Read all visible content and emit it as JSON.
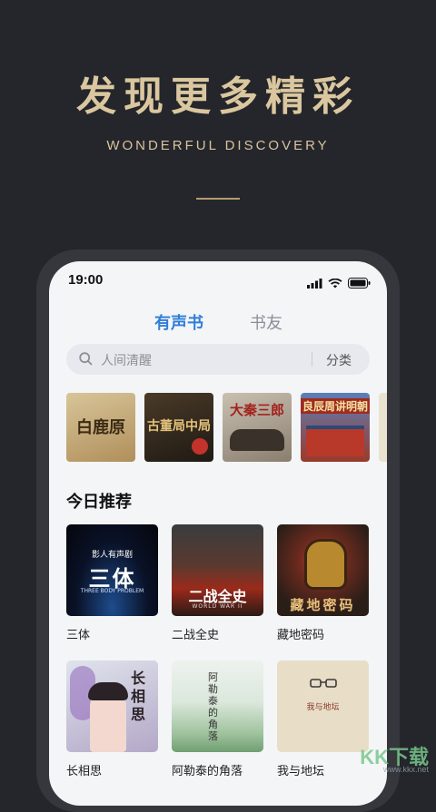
{
  "hero": {
    "title": "发现更多精彩",
    "subtitle": "WONDERFUL DISCOVERY"
  },
  "status_bar": {
    "time": "19:00",
    "icons": [
      "signal-icon",
      "wifi-icon",
      "battery-icon"
    ]
  },
  "tabs": [
    {
      "label": "有声书",
      "active": true
    },
    {
      "label": "书友",
      "active": false
    }
  ],
  "search": {
    "placeholder": "人间清醒",
    "category_label": "分类"
  },
  "featured_covers": [
    {
      "text": "白鹿原"
    },
    {
      "text": "古董局中局"
    },
    {
      "text": "大秦三郎"
    },
    {
      "text": "良辰周讲明朝"
    }
  ],
  "recommend": {
    "title": "今日推荐",
    "books": [
      {
        "title": "三体",
        "cover_main": "三体",
        "cover_top": "影人有声剧",
        "cover_sub": "THREE BODY PROBLEM"
      },
      {
        "title": "二战全史",
        "cover_main": "二战全史",
        "cover_sub": "WORLD WAR II"
      },
      {
        "title": "藏地密码",
        "cover_main": "藏地密码"
      },
      {
        "title": "长相思",
        "cover_main": "长相思"
      },
      {
        "title": "阿勒泰的角落",
        "cover_main": "阿勒泰的角落"
      },
      {
        "title": "我与地坛",
        "cover_main": "我与地坛"
      }
    ]
  },
  "watermark": {
    "brand": "KK下载",
    "url": "www.kkx.net"
  }
}
